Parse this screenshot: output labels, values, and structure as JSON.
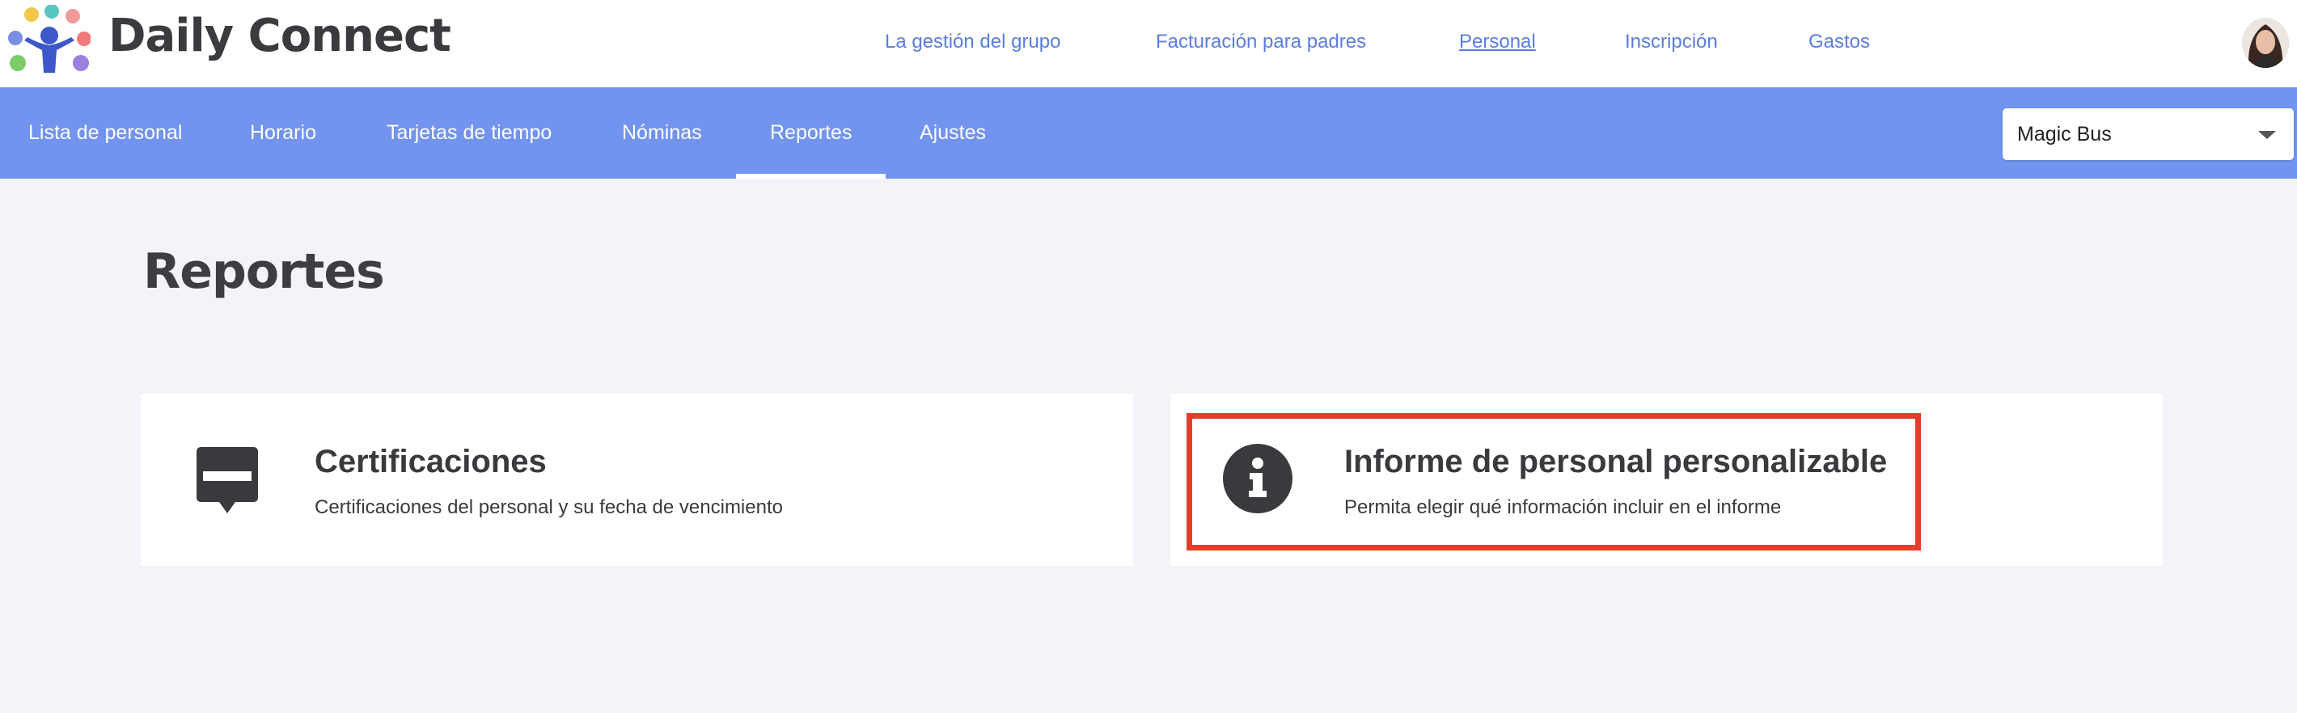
{
  "app": {
    "brand": "Daily Connect"
  },
  "top_nav": {
    "items": [
      {
        "label": "La gestión del grupo"
      },
      {
        "label": "Facturación para padres"
      },
      {
        "label": "Personal",
        "active": true
      },
      {
        "label": "Inscripción"
      },
      {
        "label": "Gastos"
      }
    ]
  },
  "sub_nav": {
    "items": [
      {
        "label": "Lista de personal"
      },
      {
        "label": "Horario"
      },
      {
        "label": "Tarjetas de tiempo"
      },
      {
        "label": "Nóminas"
      },
      {
        "label": "Reportes",
        "active": true
      },
      {
        "label": "Ajustes"
      }
    ]
  },
  "org_select": {
    "value": "Magic Bus"
  },
  "page": {
    "title": "Reportes"
  },
  "cards": [
    {
      "icon": "certificate-icon",
      "title": "Certificaciones",
      "description": "Certificaciones del personal y su fecha de vencimiento"
    },
    {
      "icon": "info-icon",
      "title": "Informe de personal personalizable",
      "description": "Permita elegir qué información incluir en el informe"
    }
  ],
  "colors": {
    "nav_blue": "#7294ee",
    "link_blue": "#5b7de0",
    "background": "#f3f4f9",
    "highlight_red": "#e53d2c"
  }
}
